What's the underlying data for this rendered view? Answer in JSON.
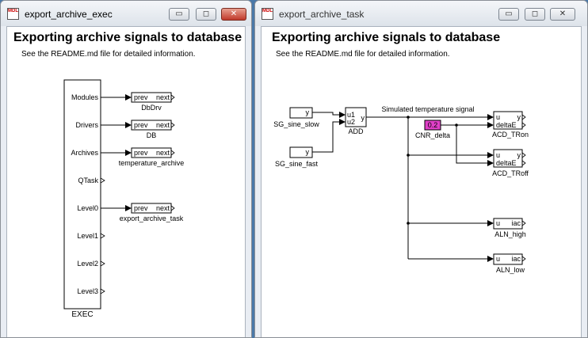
{
  "windows": {
    "exec": {
      "title": "export_archive_exec",
      "heading": "Exporting archive signals to database",
      "note": "See the README.md file for detailed information.",
      "exec_block": {
        "name": "EXEC",
        "ports": [
          "Modules",
          "Drivers",
          "Archives",
          "QTask",
          "Level0",
          "Level1",
          "Level2",
          "Level3"
        ]
      },
      "blocks": [
        {
          "in": "prev",
          "out": "next",
          "name": "DbDrv"
        },
        {
          "in": "prev",
          "out": "next",
          "name": "DB"
        },
        {
          "in": "prev",
          "out": "next",
          "name": "temperature_archive"
        },
        {
          "in": "prev",
          "out": "next",
          "name": "export_archive_task"
        }
      ]
    },
    "task": {
      "title": "export_archive_task",
      "heading": "Exporting archive signals to database",
      "note": "See the README.md file for detailed information.",
      "signal_label": "Simulated temperature signal",
      "sg_slow": {
        "port": "y",
        "name": "SG_sine_slow"
      },
      "sg_fast": {
        "port": "y",
        "name": "SG_sine_fast"
      },
      "add": {
        "in1": "u1",
        "in2": "u2",
        "out": "y",
        "name": "ADD"
      },
      "cnr": {
        "value": "0.2",
        "name": "CNR_delta"
      },
      "acd_on": {
        "in1": "u",
        "in2": "deltaE",
        "out1": "y",
        "out2": "E",
        "name": "ACD_TRon"
      },
      "acd_off": {
        "in1": "u",
        "in2": "deltaE",
        "out1": "y",
        "out2": "E",
        "name": "ACD_TRoff"
      },
      "aln_high": {
        "in": "u",
        "out": "iac",
        "name": "ALN_high"
      },
      "aln_low": {
        "in": "u",
        "out": "iac",
        "name": "ALN_low"
      }
    }
  },
  "title_buttons": {
    "minimize": "▭",
    "maximize": "◻",
    "close": "✕"
  },
  "colors": {
    "constant_fill": "#e040c8",
    "close_active": "#c0392b",
    "desktop": "#4a78a8"
  }
}
